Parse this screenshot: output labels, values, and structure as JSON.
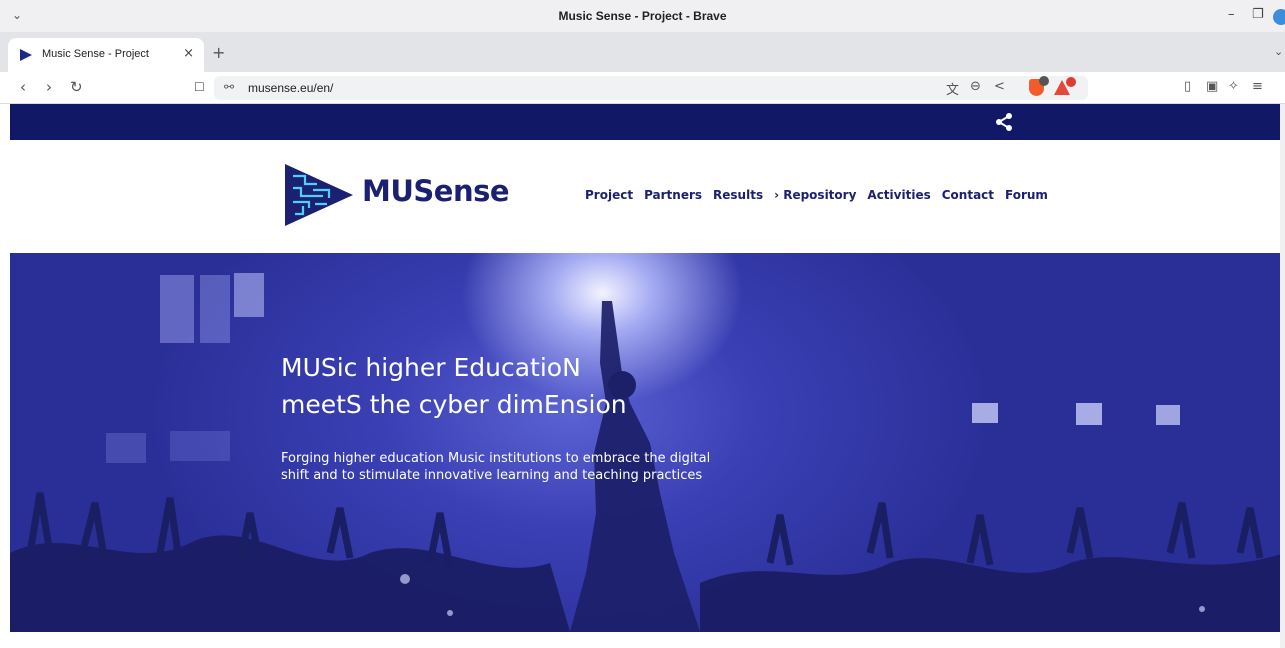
{
  "window": {
    "title": "Music Sense - Project - Brave",
    "menu_glyph": "⌄",
    "minimize": "–",
    "restore": "❐"
  },
  "tabs": [
    {
      "label": "Music Sense - Project",
      "close": "×"
    }
  ],
  "tabstrip": {
    "new_tab": "+",
    "tab_list": "⌄"
  },
  "toolbar": {
    "back": "‹",
    "forward": "›",
    "reload": "↻",
    "bookmark": "☐",
    "site_info": "⚯",
    "url": "musense.eu/en/",
    "translate": "文",
    "zoom": "⊖",
    "share": "<",
    "sidebar": "▯",
    "wallet": "▣",
    "leo": "✧",
    "menu": "≡"
  },
  "site": {
    "brand": "MUSense",
    "nav": [
      "Project",
      "Partners",
      "Results",
      "› Repository",
      "Activities",
      "Contact",
      "Forum"
    ],
    "hero": {
      "title_line1": "MUSic higher EducatioN",
      "title_line2": "meetS the cyber dimEnsion",
      "subtitle": "Forging higher education Music institutions to embrace the digital shift and to stimulate innovative learning and teaching practices"
    }
  },
  "colors": {
    "brand_navy": "#111866",
    "hero_blue": "#2a2f98",
    "nav_text": "#1b2170"
  }
}
